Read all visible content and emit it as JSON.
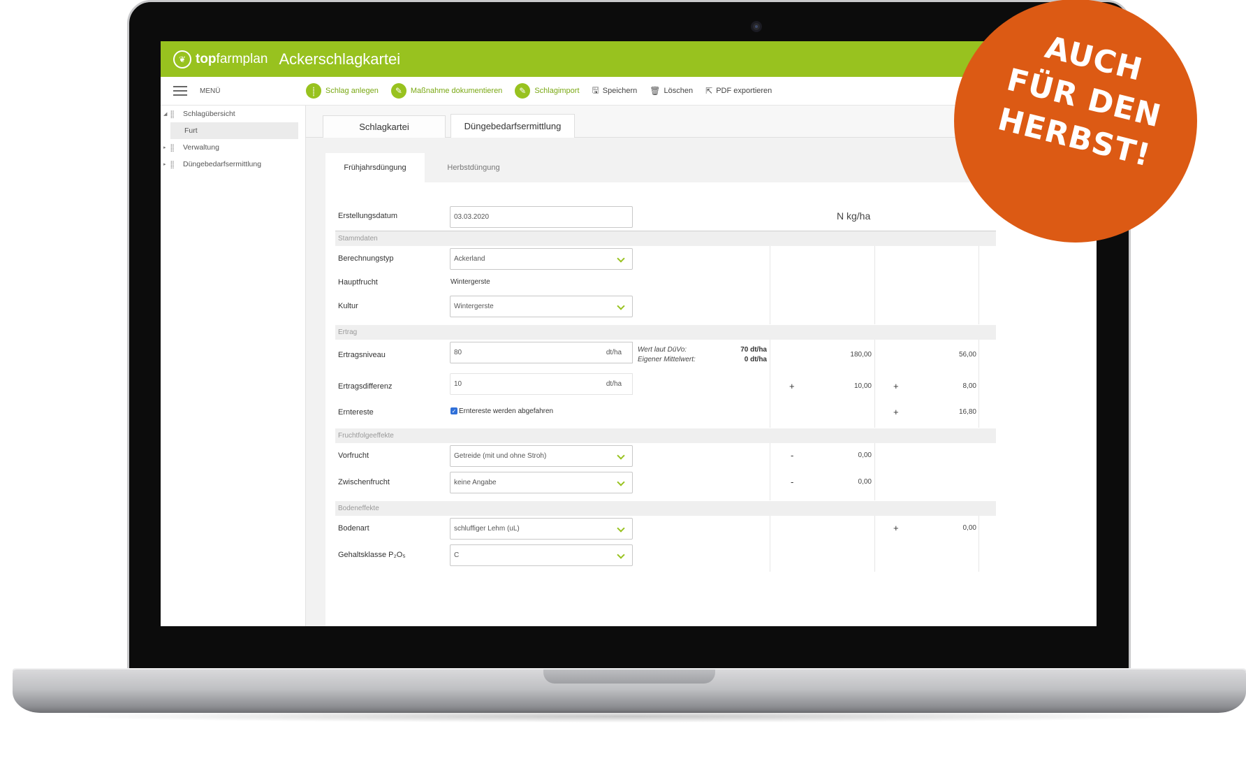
{
  "app": {
    "brand_top": "top",
    "brand_rest": "farmplan",
    "title": "Ackerschlagkartei"
  },
  "toolbar": {
    "menu_label": "MENÜ",
    "items": [
      {
        "label": "Schlag anlegen",
        "icon": "wheat-icon"
      },
      {
        "label": "Maßnahme dokumentieren",
        "icon": "pencil-icon"
      },
      {
        "label": "Schlagimport",
        "icon": "pencil-icon"
      },
      {
        "label": "Speichern",
        "icon": "save-icon"
      },
      {
        "label": "Löschen",
        "icon": "trash-icon"
      },
      {
        "label": "PDF exportieren",
        "icon": "export-icon"
      }
    ]
  },
  "sidebar": {
    "items": [
      {
        "label": "Schlagübersicht",
        "expanded": true
      },
      {
        "label": "Furt",
        "child": true
      },
      {
        "label": "Verwaltung",
        "expanded": false
      },
      {
        "label": "Düngebedarfsermittlung",
        "expanded": false
      }
    ]
  },
  "tabs": {
    "main": [
      "Schlagkartei",
      "Düngebedarfsermittlung"
    ],
    "sub": [
      "Frühjahrsdüngung",
      "Herbstdüngung"
    ]
  },
  "form": {
    "erstellungsdatum_label": "Erstellungsdatum",
    "erstellungsdatum_value": "03.03.2020",
    "unit_header": "N kg/ha",
    "sections": {
      "stammdaten": "Stammdaten",
      "ertrag": "Ertrag",
      "fruchtfolge": "Fruchtfolgeeffekte",
      "boden": "Bodeneffekte"
    },
    "berechnungstyp_label": "Berechnungstyp",
    "berechnungstyp_value": "Ackerland",
    "hauptfrucht_label": "Hauptfrucht",
    "hauptfrucht_value": "Wintergerste",
    "kultur_label": "Kultur",
    "kultur_value": "Wintergerste",
    "ertragsniveau_label": "Ertragsniveau",
    "ertragsniveau_value": "80",
    "ertragsniveau_unit": "dt/ha",
    "wert_duevo_label": "Wert laut DüVo:",
    "wert_duevo_value": "70 dt/ha",
    "mittelwert_label": "Eigener Mittelwert:",
    "mittelwert_value": "0 dt/ha",
    "ertragsniveau_col1": "180,00",
    "ertragsniveau_col2": "56,00",
    "ertragsdifferenz_label": "Ertragsdifferenz",
    "ertragsdifferenz_value": "10",
    "ertragsdifferenz_unit": "dt/ha",
    "ertragsdifferenz_op1": "+",
    "ertragsdifferenz_col1": "10,00",
    "ertragsdifferenz_op2": "+",
    "ertragsdifferenz_col2": "8,00",
    "erntereste_label": "Erntereste",
    "erntereste_checkbox": "Erntereste werden abgefahren",
    "erntereste_op2": "+",
    "erntereste_col2": "16,80",
    "vorfrucht_label": "Vorfrucht",
    "vorfrucht_value": "Getreide (mit und ohne Stroh)",
    "vorfrucht_op1": "-",
    "vorfrucht_col1": "0,00",
    "zwischenfrucht_label": "Zwischenfrucht",
    "zwischenfrucht_value": "keine Angabe",
    "zwischenfrucht_op1": "-",
    "zwischenfrucht_col1": "0,00",
    "bodenart_label": "Bodenart",
    "bodenart_value": "schluffiger Lehm (uL)",
    "bodenart_op2": "+",
    "bodenart_col2": "0,00",
    "gehaltsklasse_label": "Gehaltsklasse P₂O₅",
    "gehaltsklasse_value": "C"
  },
  "badge": {
    "line1": "AUCH",
    "line2": "FÜR DEN",
    "line3": "HERBST!",
    "color": "#dc5a14"
  },
  "colors": {
    "brand_green": "#98c21f"
  }
}
